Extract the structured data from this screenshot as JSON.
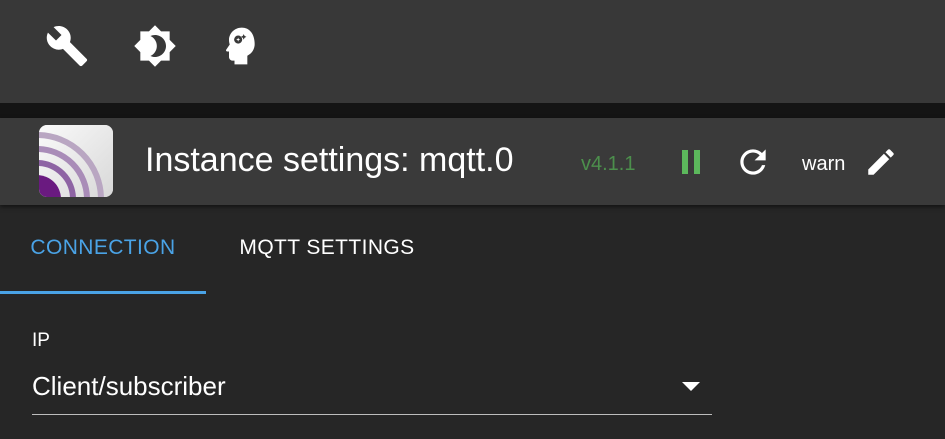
{
  "toolbar": {
    "icons": [
      "wrench-icon",
      "brightness-icon",
      "expert-mode-icon"
    ]
  },
  "instance": {
    "title": "Instance settings: mqtt.0",
    "version": "v4.1.1",
    "log_level": "warn",
    "colors": {
      "version": "#4c8f4c",
      "pause": "#5cb85c",
      "accent": "#4aa3e6"
    }
  },
  "tabs": [
    {
      "label": "CONNECTION",
      "active": true
    },
    {
      "label": "MQTT SETTINGS",
      "active": false
    }
  ],
  "form": {
    "ip_label": "IP",
    "ip_value": "Client/subscriber"
  }
}
